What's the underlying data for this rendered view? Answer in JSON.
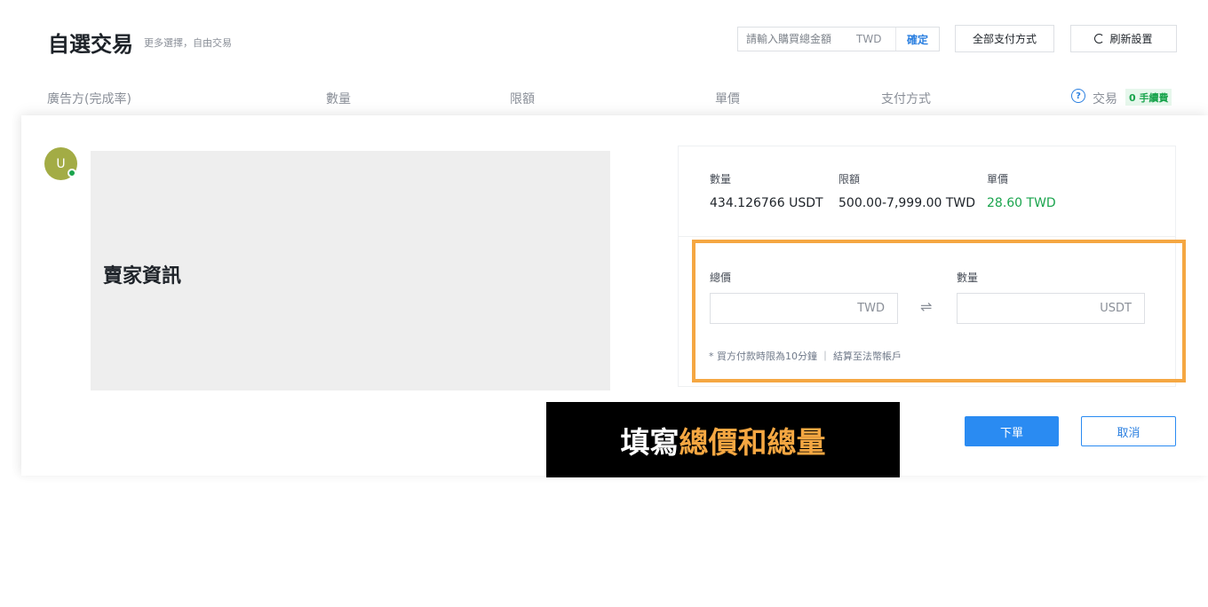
{
  "header": {
    "title": "自選交易",
    "subtitle": "更多選擇，自由交易",
    "amount_placeholder": "請輸入購買總金額",
    "amount_currency": "TWD",
    "confirm_label": "確定",
    "payment_filter_label": "全部支付方式",
    "refresh_label": "刷新設置"
  },
  "columns": {
    "advertiser": "廣告方(完成率)",
    "quantity": "數量",
    "limit": "限額",
    "price": "單價",
    "payment": "支付方式",
    "trade": "交易",
    "fee_badge": "0 手續費"
  },
  "seller": {
    "avatar_letter": "U",
    "info_label": "賣家資訊"
  },
  "offer": {
    "quantity_label": "數量",
    "quantity_value": "434.126766 USDT",
    "limit_label": "限額",
    "limit_value": "500.00-7,999.00 TWD",
    "price_label": "單價",
    "price_value": "28.60 TWD"
  },
  "form": {
    "total_label": "總價",
    "total_currency": "TWD",
    "quantity_label": "數量",
    "quantity_currency": "USDT",
    "note": "* 買方付款時限為10分鐘 ｜ 結算至法幣帳戶"
  },
  "caption": {
    "prefix": "填寫",
    "highlight": "總價和總量"
  },
  "actions": {
    "order_label": "下單",
    "cancel_label": "取消"
  },
  "colors": {
    "accent_blue": "#2a8bf2",
    "price_green": "#1aa44d",
    "highlight_orange": "#f5a742"
  }
}
